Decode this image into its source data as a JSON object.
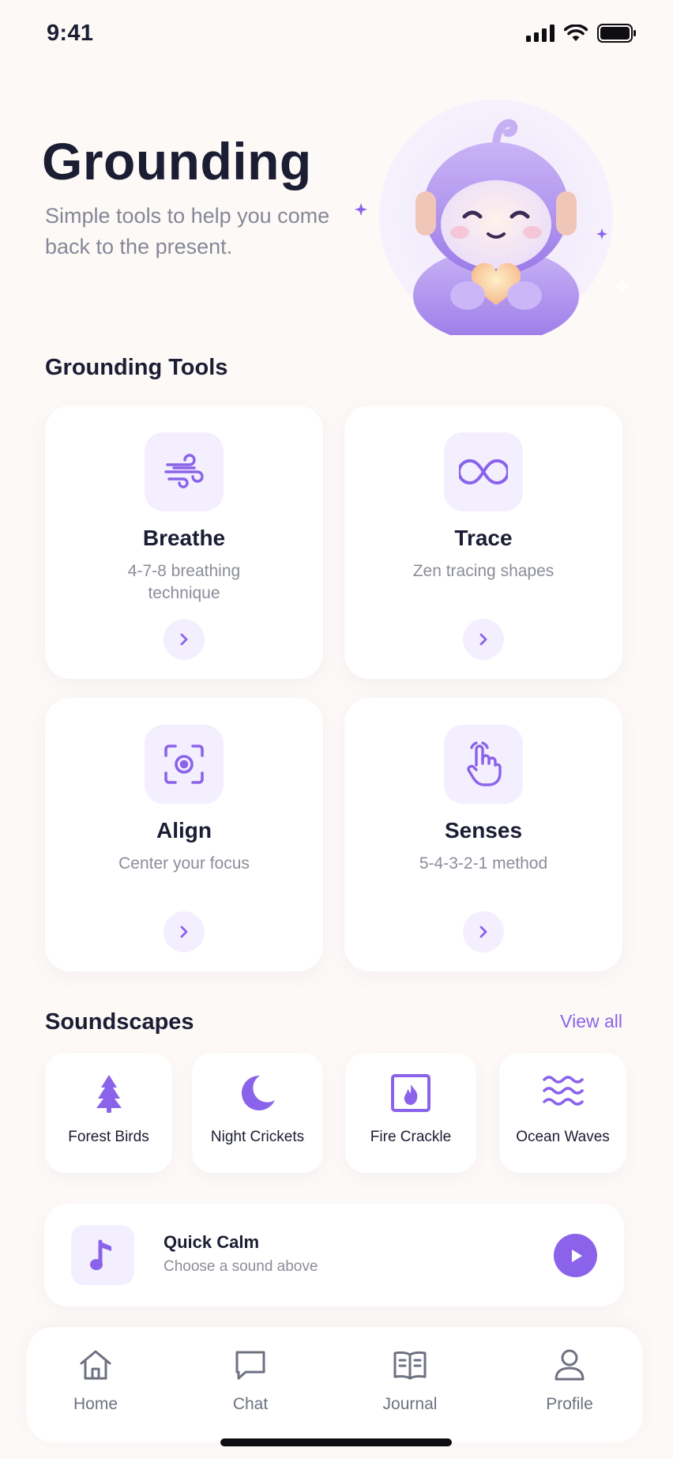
{
  "status_bar": {
    "time": "9:41",
    "icons": [
      "signal-icon",
      "wifi-icon",
      "battery-icon"
    ]
  },
  "hero": {
    "title": "Grounding",
    "subtitle": "Simple tools to help you come back to the present.",
    "mascot": "smiling-mascot-with-headphones-holding-heart"
  },
  "tools": {
    "heading": "Grounding Tools",
    "items": [
      {
        "title": "Breathe",
        "desc": "4-7-8 breathing technique",
        "icon": "wind-icon"
      },
      {
        "title": "Trace",
        "desc": "Zen tracing shapes",
        "icon": "infinity-icon"
      },
      {
        "title": "Align",
        "desc": "Center your focus",
        "icon": "focus-icon"
      },
      {
        "title": "Senses",
        "desc": "5-4-3-2-1 method",
        "icon": "hand-pointer-icon"
      }
    ]
  },
  "soundscapes": {
    "heading": "Soundscapes",
    "view_all": "View all",
    "items": [
      {
        "label": "Forest Birds",
        "icon": "tree-icon"
      },
      {
        "label": "Night Crickets",
        "icon": "moon-icon"
      },
      {
        "label": "Fire Crackle",
        "icon": "fireplace-icon"
      },
      {
        "label": "Ocean Waves",
        "icon": "waves-icon"
      }
    ]
  },
  "quick_calm": {
    "title": "Quick Calm",
    "subtitle": "Choose a sound above",
    "icon": "music-note-icon",
    "action_icon": "play-icon"
  },
  "nav": {
    "items": [
      {
        "label": "Home",
        "icon": "home-icon"
      },
      {
        "label": "Chat",
        "icon": "chat-icon"
      },
      {
        "label": "Journal",
        "icon": "book-icon"
      },
      {
        "label": "Profile",
        "icon": "user-icon"
      }
    ]
  },
  "colors": {
    "accent": "#8b63ea",
    "accent_soft": "#f3effe",
    "background": "#fcf9f7",
    "text_primary": "#1b1d33",
    "text_secondary": "#8b8d99"
  }
}
